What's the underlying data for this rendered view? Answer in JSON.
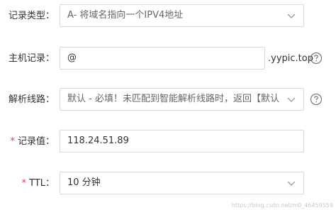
{
  "form": {
    "record_type": {
      "label": "记录类型：",
      "value": "A- 将域名指向一个IPV4地址"
    },
    "host": {
      "label": "主机记录：",
      "value": "@",
      "suffix": ".yypic.top"
    },
    "line": {
      "label": "解析线路：",
      "value": "默认 - 必填！未匹配到智能解析线路时，返回【默认】线路..."
    },
    "record_value": {
      "required_mark": "*",
      "label": "记录值：",
      "value": "118.24.51.89"
    },
    "ttl": {
      "required_mark": "*",
      "label": "TTL：",
      "value": "10 分钟"
    }
  },
  "watermark": "https://blog.csdn.net/m0_46459559",
  "icons": {
    "dropdown": "chevron-down-icon",
    "help": "question-circle-icon"
  },
  "colors": {
    "required": "#e4393c",
    "border": "#d9d9d9",
    "text": "#333333"
  }
}
